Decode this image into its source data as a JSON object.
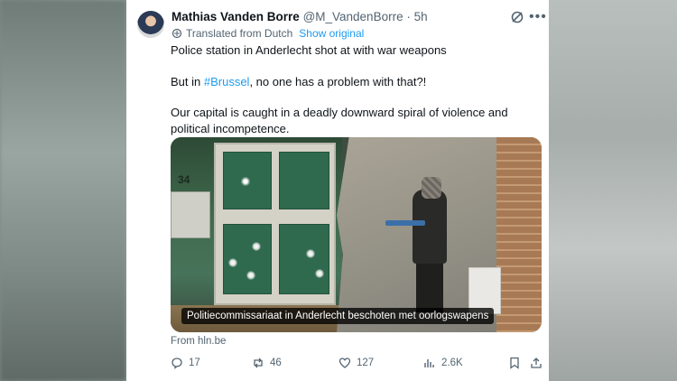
{
  "tweet": {
    "author_name": "Mathias Vanden Borre",
    "handle": "@M_VandenBorre",
    "separator": "·",
    "time": "5h",
    "translated_label": "Translated from Dutch",
    "show_original": "Show original",
    "text_line1": "Police station in Anderlecht shot at with war weapons",
    "text_line2_before": "But in ",
    "hashtag": "#Brussel",
    "text_line2_after": ", no one has a problem with that?!",
    "text_line3": "Our capital is caught in a deadly downward spiral of violence and political incompetence."
  },
  "media": {
    "house_number": "34",
    "caption": "Politiecommissariaat in Anderlecht beschoten met oorlogswapens"
  },
  "source": "From hln.be",
  "actions": {
    "replies": "17",
    "reposts": "46",
    "likes": "127",
    "views": "2.6K"
  },
  "icons": [
    "grok-icon",
    "more-icon",
    "translate-icon",
    "reply-icon",
    "repost-icon",
    "like-icon",
    "views-icon",
    "bookmark-icon",
    "share-icon"
  ],
  "colors": {
    "accent": "#1d9bf0",
    "text": "#0f1419",
    "muted": "#536471"
  }
}
